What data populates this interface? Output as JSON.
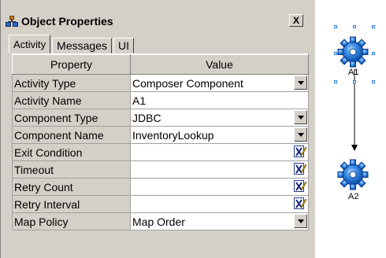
{
  "window": {
    "title": "Object Properties",
    "close_label": "X"
  },
  "tabs": [
    {
      "label": "Activity"
    },
    {
      "label": "Messages"
    },
    {
      "label": "UI"
    }
  ],
  "table": {
    "headers": [
      "Property",
      "Value"
    ],
    "rows": [
      {
        "property": "Activity Type",
        "value": "Composer Component",
        "control": "dropdown"
      },
      {
        "property": "Activity Name",
        "value": "A1",
        "control": "text"
      },
      {
        "property": "Component Type",
        "value": "JDBC",
        "control": "dropdown"
      },
      {
        "property": "Component Name",
        "value": "InventoryLookup",
        "control": "dropdown"
      },
      {
        "property": "Exit Condition",
        "value": "",
        "control": "editor"
      },
      {
        "property": "Timeout",
        "value": "",
        "control": "editor"
      },
      {
        "property": "Retry Count",
        "value": "",
        "control": "editor"
      },
      {
        "property": "Retry Interval",
        "value": "",
        "control": "editor"
      },
      {
        "property": "Map Policy",
        "value": "Map Order",
        "control": "dropdown"
      }
    ]
  },
  "canvas": {
    "nodes": [
      {
        "label": "A1",
        "selected": true,
        "icon": "gear-icon"
      },
      {
        "label": "A2",
        "selected": false,
        "icon": "gear-icon"
      }
    ],
    "accent_color": "#2c7bd8"
  }
}
